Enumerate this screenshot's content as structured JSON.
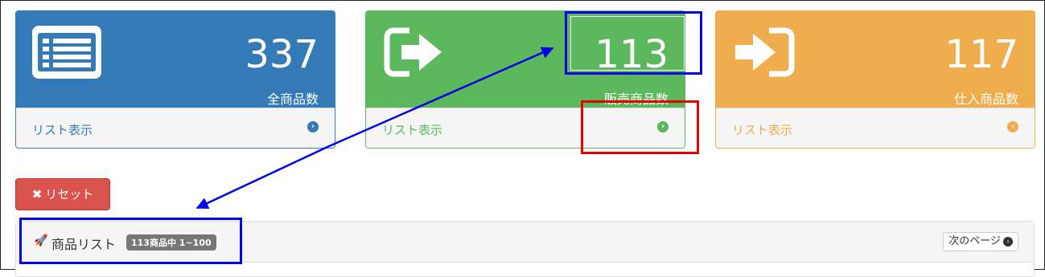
{
  "panels": [
    {
      "count": "337",
      "label": "全商品数",
      "link": "リスト表示",
      "icon": "list-icon",
      "color": "#337ab7"
    },
    {
      "count": "113",
      "label": "販売商品数",
      "link": "リスト表示",
      "icon": "sign-out-icon",
      "color": "#5cb85c"
    },
    {
      "count": "117",
      "label": "仕入商品数",
      "link": "リスト表示",
      "icon": "sign-in-icon",
      "color": "#f0ad4e"
    }
  ],
  "reset": {
    "label": "リセット",
    "icon": "times-icon",
    "color": "#d9534f"
  },
  "product_list": {
    "title": "商品リスト",
    "badge": "113商品中 1~100",
    "icon": "rocket-icon",
    "next_label": "次のページ",
    "next_icon": "arrow-circle-right-icon"
  },
  "annotations": {
    "blue": "#0000e6",
    "red": "#e60000"
  }
}
